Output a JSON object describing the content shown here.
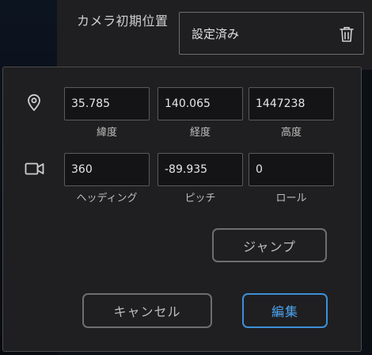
{
  "camera": {
    "label": "カメラ初期位置",
    "value": "設定済み",
    "delete_icon": "trash-icon"
  },
  "position": {
    "icon": "map-pin-icon",
    "latitude": {
      "value": "35.785",
      "label": "緯度"
    },
    "longitude": {
      "value": "140.065",
      "label": "経度"
    },
    "altitude": {
      "value": "1447238",
      "label": "高度"
    }
  },
  "orientation": {
    "icon": "video-camera-icon",
    "heading": {
      "value": "360",
      "label": "ヘッディング"
    },
    "pitch": {
      "value": "-89.935",
      "label": "ピッチ"
    },
    "roll": {
      "value": "0",
      "label": "ロール"
    }
  },
  "actions": {
    "jump_label": "ジャンプ",
    "cancel_label": "キャンセル",
    "edit_label": "編集"
  },
  "colors": {
    "accent": "#3c8fd8",
    "panel": "#1f1f21",
    "background": "#0b0f16"
  }
}
